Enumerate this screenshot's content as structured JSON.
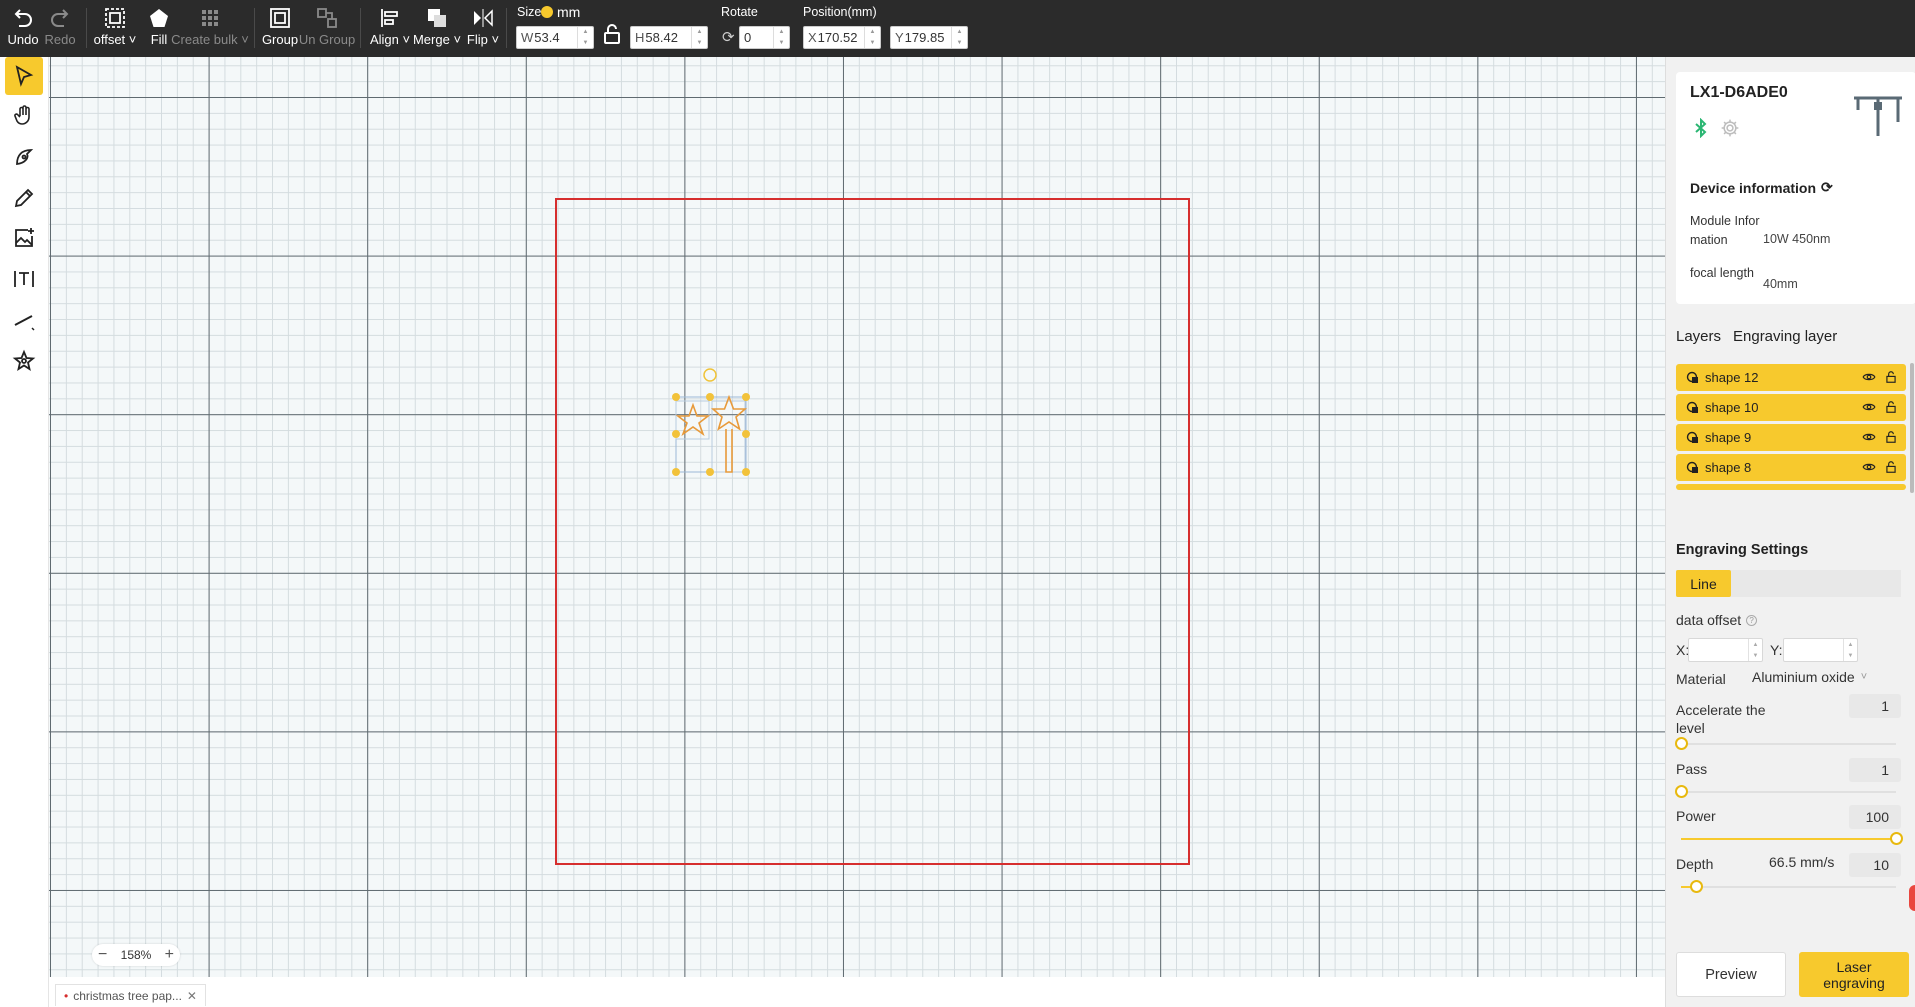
{
  "toolbar": {
    "undo": "Undo",
    "redo": "Redo",
    "offset": "offset",
    "fill": "Fill",
    "create_bulk": "Create bulk",
    "group": "Group",
    "ungroup": "Un Group",
    "align": "Align",
    "merge": "Merge",
    "flip": "Flip",
    "size_label": "Size",
    "unit": "mm",
    "width_prefix": "W",
    "width_value": "53.4",
    "height_prefix": "H",
    "height_value": "58.42",
    "rotate_label": "Rotate",
    "rotate_value": "0",
    "position_label": "Position(mm)",
    "x_prefix": "X",
    "x_value": "170.52",
    "y_prefix": "Y",
    "y_value": "179.85"
  },
  "left_tools": [
    "select",
    "hand",
    "pen",
    "pencil",
    "image",
    "text",
    "line",
    "shape"
  ],
  "canvas": {
    "zoom": "158%",
    "file_tab": "christmas tree pap..."
  },
  "device": {
    "name": "LX1-D6ADE0",
    "info_title": "Device information",
    "module_label": "Module Information",
    "module_value": "10W 450nm",
    "focal_label": "focal length",
    "focal_value": "40mm"
  },
  "layers": {
    "tab_layers": "Layers",
    "tab_engraving": "Engraving layer",
    "items": [
      {
        "label": "shape 12"
      },
      {
        "label": "shape 10"
      },
      {
        "label": "shape 9"
      },
      {
        "label": "shape 8"
      }
    ]
  },
  "engraving": {
    "title": "Engraving Settings",
    "mode_tab": "Line",
    "data_offset": "data offset",
    "x_label": "X:",
    "y_label": "Y:",
    "material_label": "Material",
    "material_value": "Aluminium oxide",
    "accel_label": "Accelerate the level",
    "accel_value": "1",
    "pass_label": "Pass",
    "pass_value": "1",
    "power_label": "Power",
    "power_value": "100",
    "depth_label": "Depth",
    "speed": "66.5 mm/s",
    "depth_value": "10",
    "accel_level": 0.0,
    "pass_level": 0.0,
    "power_level": 1.0,
    "depth_level": 0.07
  },
  "actions": {
    "preview": "Preview",
    "laser": "Laser engraving"
  },
  "colors": {
    "accent": "#f7c92d",
    "toolbar_bg": "#2b2b2b",
    "work_area_border": "#d62e2e",
    "bluetooth": "#2bb673"
  }
}
